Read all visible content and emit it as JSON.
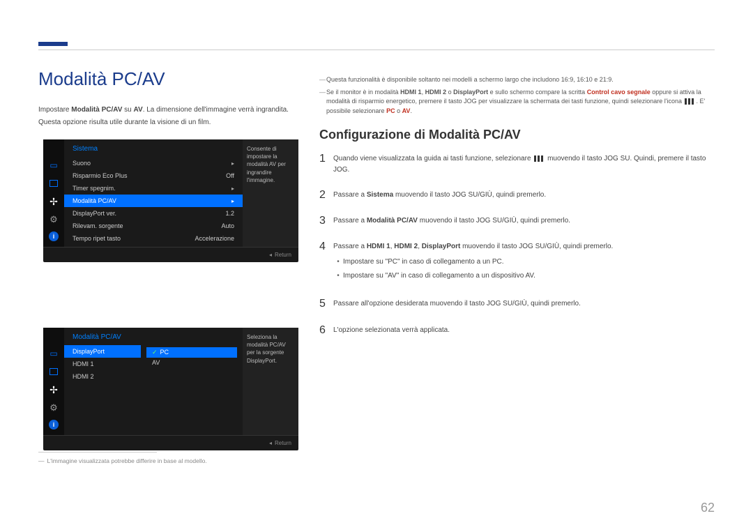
{
  "pageTitle": "Modalità PC/AV",
  "intro1_a": "Impostare ",
  "intro1_b": "Modalità PC/AV",
  "intro1_c": " su ",
  "intro1_d": "AV",
  "intro1_e": ". La dimensione dell'immagine verrà ingrandita.",
  "intro2": "Questa opzione risulta utile durante la visione di un film.",
  "osd1": {
    "title": "Sistema",
    "rows": [
      {
        "label": "Suono",
        "value": "",
        "arrow": "▸",
        "sel": false
      },
      {
        "label": "Risparmio Eco Plus",
        "value": "Off",
        "arrow": "",
        "sel": false
      },
      {
        "label": "Timer spegnim.",
        "value": "",
        "arrow": "▸",
        "sel": false
      },
      {
        "label": "Modalità PC/AV",
        "value": "",
        "arrow": "▸",
        "sel": true
      },
      {
        "label": "DisplayPort ver.",
        "value": "1.2",
        "arrow": "",
        "sel": false
      },
      {
        "label": "Rilevam. sorgente",
        "value": "Auto",
        "arrow": "",
        "sel": false
      },
      {
        "label": "Tempo ripet tasto",
        "value": "Accelerazione",
        "arrow": "",
        "sel": false
      }
    ],
    "side": "Consente di impostare la modalità AV per ingrandire l'immagine.",
    "return": "Return"
  },
  "osd2": {
    "title": "Modalità PC/AV",
    "sub": [
      {
        "label": "DisplayPort",
        "sel": true
      },
      {
        "label": "HDMI 1",
        "sel": false
      },
      {
        "label": "HDMI 2",
        "sel": false
      }
    ],
    "opts": [
      {
        "label": "PC",
        "sel": true,
        "check": true
      },
      {
        "label": "AV",
        "sel": false,
        "check": false
      }
    ],
    "side": "Seleziona la modalità PC/AV per la sorgente DisplayPort.",
    "return": "Return"
  },
  "footnote": "L'immagine visualizzata potrebbe differire in base al modello.",
  "note1": "Questa funzionalità è disponibile soltanto nei modelli a schermo largo che includono 16:9, 16:10 e 21:9.",
  "note2_a": "Se il monitor è in modalità ",
  "note2_hdmi1": "HDMI 1",
  "note2_b": ", ",
  "note2_hdmi2": "HDMI 2",
  "note2_c": " o ",
  "note2_dp": "DisplayPort",
  "note2_d": " e sullo schermo compare la scritta ",
  "note2_ctrl": "Control cavo segnale",
  "note2_e": " oppure si attiva la modalità di risparmio energetico, premere il tasto JOG per visualizzare la schermata dei tasti funzione, quindi selezionare l'icona ",
  "note2_f": ". E' possibile selezionare ",
  "note2_pc": "PC",
  "note2_g": " o ",
  "note2_av": "AV",
  "note2_h": ".",
  "sectionTitle": "Configurazione di Modalità PC/AV",
  "steps": [
    {
      "n": "1",
      "a": "Quando viene visualizzata la guida ai tasti funzione, selezionare ",
      "b": " muovendo il tasto JOG SU. Quindi, premere il tasto JOG.",
      "icon": true
    },
    {
      "n": "2",
      "a": "Passare a ",
      "bold": "Sistema",
      "b": " muovendo il tasto JOG SU/GIÙ, quindi premerlo."
    },
    {
      "n": "3",
      "a": "Passare a ",
      "bold": "Modalità PC/AV",
      "b": " muovendo il tasto JOG SU/GIÙ, quindi premerlo."
    },
    {
      "n": "4",
      "a": "Passare a ",
      "bold": "HDMI 1",
      "mid1": ", ",
      "bold2": "HDMI 2",
      "mid2": ", ",
      "bold3": "DisplayPort",
      "b": " muovendo il tasto JOG SU/GIÙ, quindi premerlo.",
      "bullets": [
        "Impostare su \"PC\" in caso di collegamento a un PC.",
        "Impostare su \"AV\" in caso di collegamento a un dispositivo AV."
      ]
    },
    {
      "n": "5",
      "a": "Passare all'opzione desiderata muovendo il tasto JOG SU/GIÙ, quindi premerlo."
    },
    {
      "n": "6",
      "a": "L'opzione selezionata verrà applicata."
    }
  ],
  "pageNum": "62"
}
